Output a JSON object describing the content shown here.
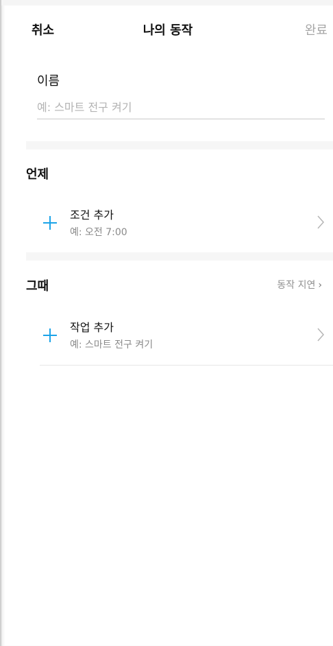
{
  "nav": {
    "cancel_label": "취소",
    "title": "나의 동작",
    "done_label": "완료"
  },
  "name_section": {
    "label": "이름",
    "input_value": "",
    "placeholder": "예: 스마트 전구 켜기"
  },
  "when_section": {
    "title": "언제",
    "add_condition": {
      "label": "조건 추가",
      "example": "예: 오전 7:00",
      "icon": "plus-icon"
    }
  },
  "then_section": {
    "title": "그때",
    "delay_link": "동작 지연",
    "add_action": {
      "label": "작업 추가",
      "example": "예: 스마트 전구 켜기",
      "icon": "plus-icon"
    }
  },
  "colors": {
    "accent": "#1aa3e8",
    "disabled_text": "#a6a6a6",
    "secondary_text": "#8a8a8a",
    "section_separator": "#f6f6f6"
  }
}
